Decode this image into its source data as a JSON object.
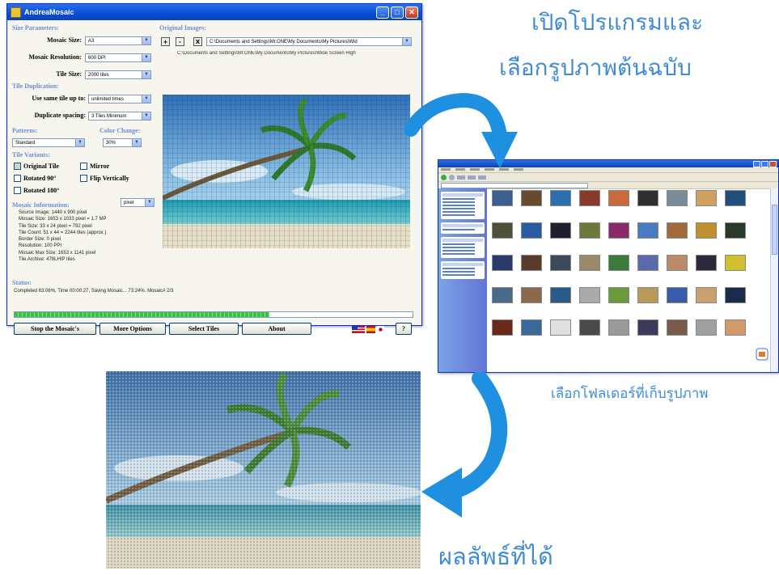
{
  "window": {
    "title": "AndreaMosaic",
    "min_label": "_",
    "max_label": "□",
    "close_label": "✕"
  },
  "size_params": {
    "section": "Size Parameters:",
    "mosaic_size_label": "Mosaic Size:",
    "mosaic_size_value": "A3",
    "mosaic_resolution_label": "Mosaic Resolution:",
    "mosaic_resolution_value": "600 DPI",
    "tile_size_label": "Tile Size:",
    "tile_size_value": "2000 tiles"
  },
  "tile_duplication": {
    "section": "Tile Duplication:",
    "use_same_label": "Use same tile up to:",
    "use_same_value": "unlimited times",
    "spacing_label": "Duplicate spacing:",
    "spacing_value": "3 Tiles Minimum"
  },
  "patterns": {
    "section": "Patterns:",
    "value": "Standard"
  },
  "color_change": {
    "section": "Color Change:",
    "value": "30%"
  },
  "tile_variants": {
    "section": "Tile Variants:",
    "original": "Original Tile",
    "mirror": "Mirror",
    "rotated90": "Rotated 90°",
    "flip_vertically": "Flip Vertically",
    "rotated180": "Rotated 180°"
  },
  "mosaic_info": {
    "section": "Mosaic Information:",
    "unit": "pixel",
    "lines": [
      "Source Image: 1440 x 900 pixel",
      "Mosaic Size: 1653 x 1033 pixel = 1.7 MP",
      "Tile Size: 33 x 24 pixel = 792 pixel",
      "Tile Count: 51 x 44 = 2244 tiles (approx.)",
      "Border Size: 0 pixel",
      "Resolution: 100 PPI",
      "Mosaic Max Size: 1653 x 1141 pixel",
      "Tile Archive: 478LHIP tiles"
    ]
  },
  "original_images": {
    "section": "Original Images:",
    "add": "+",
    "remove": "-",
    "clear": "X",
    "path_combo": "C:\\Documents and Settings\\Mr.ONE\\My Documents\\My Pictures\\Wid",
    "path_full": "C:\\Documents and Settings\\Mr.ONE\\My Documents\\My Pictures\\Wide Screen High"
  },
  "status": {
    "section": "Status:",
    "text": "Completed 63.06%, Time 00:00:27, Saving Mosaic... 73.24%. Mosaic# 2/3",
    "progress": 0.64
  },
  "buttons": {
    "stop": "Stop the Mosaic's",
    "more": "More Options",
    "select": "Select Tiles",
    "about": "About",
    "help": "?"
  },
  "captions": {
    "open_program": "เปิดโปรแกรมและ",
    "select_original": "เลือกรูปภาพต้นฉบับ",
    "select_folder": "เลือกโฟลเดอร์ที่เก็บรูปภาพ",
    "result": "ผลลัพธ์ที่ได้"
  },
  "colors": {
    "caption_blue": "#3f8bd7",
    "arrow_blue": "#1f8fe0",
    "xp_title_blue": "#0a4fd6",
    "progress_green": "#3ac248"
  }
}
